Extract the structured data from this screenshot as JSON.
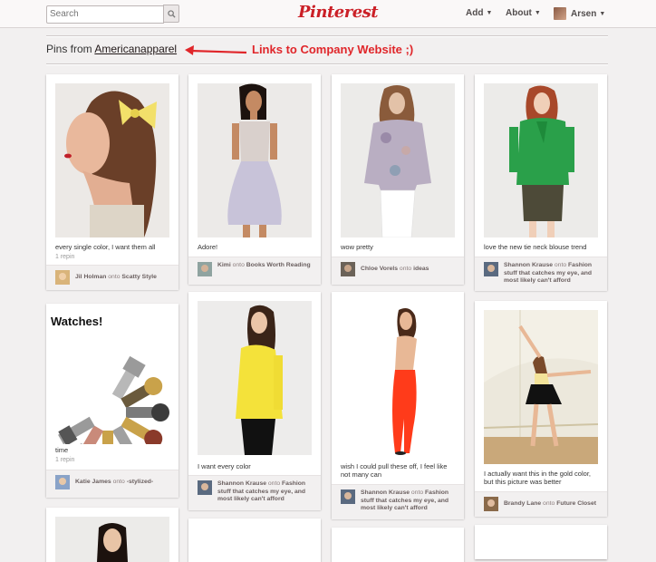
{
  "header": {
    "search_placeholder": "Search",
    "logo": "Pinterest",
    "nav": {
      "add": "Add",
      "about": "About",
      "user": "Arsen"
    }
  },
  "board": {
    "prefix": "Pins from ",
    "source": "Americanapparel",
    "annotation": "Links to Company Website ;)"
  },
  "pins": [
    {
      "desc": "every single color, I want them all",
      "repins": "1 repin",
      "user": "Jil Holman",
      "onto": " onto ",
      "board": "Scatty Style"
    },
    {
      "desc": "Adore!",
      "repins": "",
      "user": "Kimi",
      "onto": " onto ",
      "board": "Books Worth Reading"
    },
    {
      "desc": "wow pretty",
      "repins": "",
      "user": "Chloe Vorels",
      "onto": " onto ",
      "board": "ideas"
    },
    {
      "desc": "love the new tie neck blouse trend",
      "repins": "",
      "user": "Shannon Krause",
      "onto": " onto ",
      "board": "Fashion stuff that catches my eye, and most likely can't afford"
    },
    {
      "title": "Watches!",
      "desc": "time",
      "repins": "1 repin",
      "user": "Katie James",
      "onto": " onto ",
      "board": "-stylized-"
    },
    {
      "desc": "I want every color",
      "repins": "",
      "user": "Shannon Krause",
      "onto": " onto ",
      "board": "Fashion stuff that catches my eye, and most likely can't afford"
    },
    {
      "desc": "wish I could pull these off, I feel like not many can",
      "repins": "",
      "user": "Shannon Krause",
      "onto": " onto ",
      "board": "Fashion stuff that catches my eye, and most likely can't afford"
    },
    {
      "desc": "I actually want this in the gold color, but this picture was better",
      "repins": "",
      "user": "Brandy Lane",
      "onto": " onto ",
      "board": "Future Closet"
    }
  ],
  "colors": {
    "brand": "#cb2027",
    "annotation": "#e0262a"
  }
}
